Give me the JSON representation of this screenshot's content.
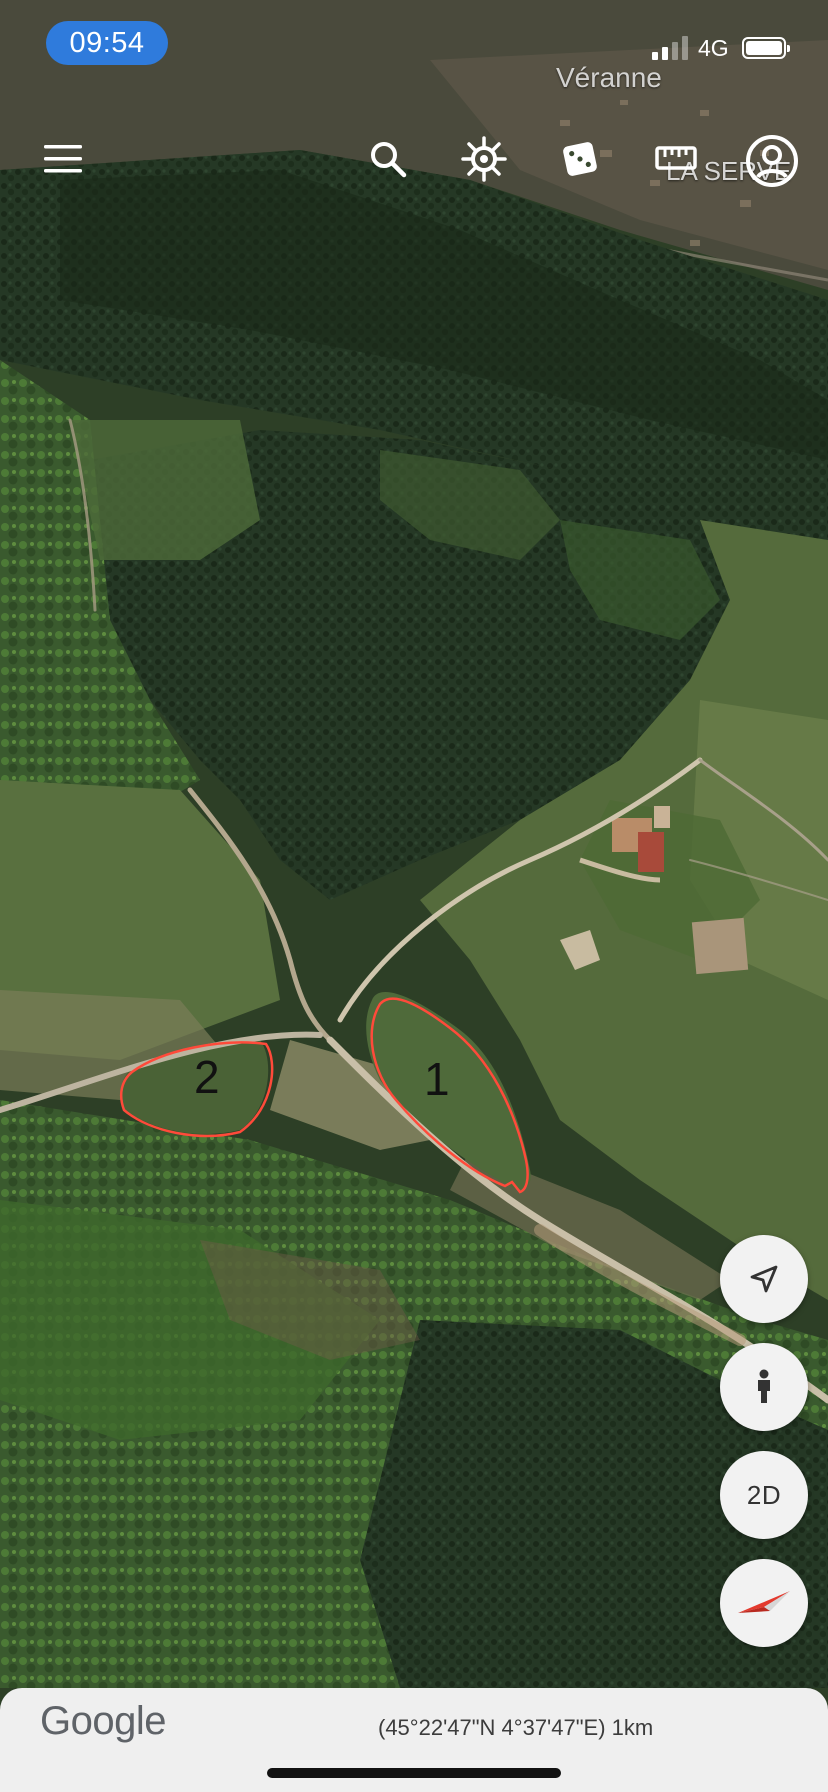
{
  "status_bar": {
    "time": "09:54",
    "network": "4G"
  },
  "map": {
    "labels": {
      "village": "Véranne",
      "locality": "LA SERVE"
    },
    "drawn_areas": [
      {
        "label": "1",
        "stroke_color": "#ff4a3a"
      },
      {
        "label": "2",
        "stroke_color": "#ff4a3a"
      }
    ]
  },
  "toolbar": {
    "icons": [
      "menu-icon",
      "search-icon",
      "voyager-helm-icon",
      "feeling-lucky-dice-icon",
      "measure-ruler-icon",
      "account-icon"
    ]
  },
  "controls": {
    "location_icon": "my-location-arrow-icon",
    "street_view_icon": "pegman-icon",
    "view_mode": "2D",
    "compass_icon": "compass-icon"
  },
  "footer": {
    "logo": "Google",
    "coordinates": "(45°22'47\"N 4°37'47\"E) 1km"
  },
  "colors": {
    "time_pill": "#2f7bdc",
    "annotation": "#ff4a3a",
    "compass_red": "#e33a2e"
  }
}
